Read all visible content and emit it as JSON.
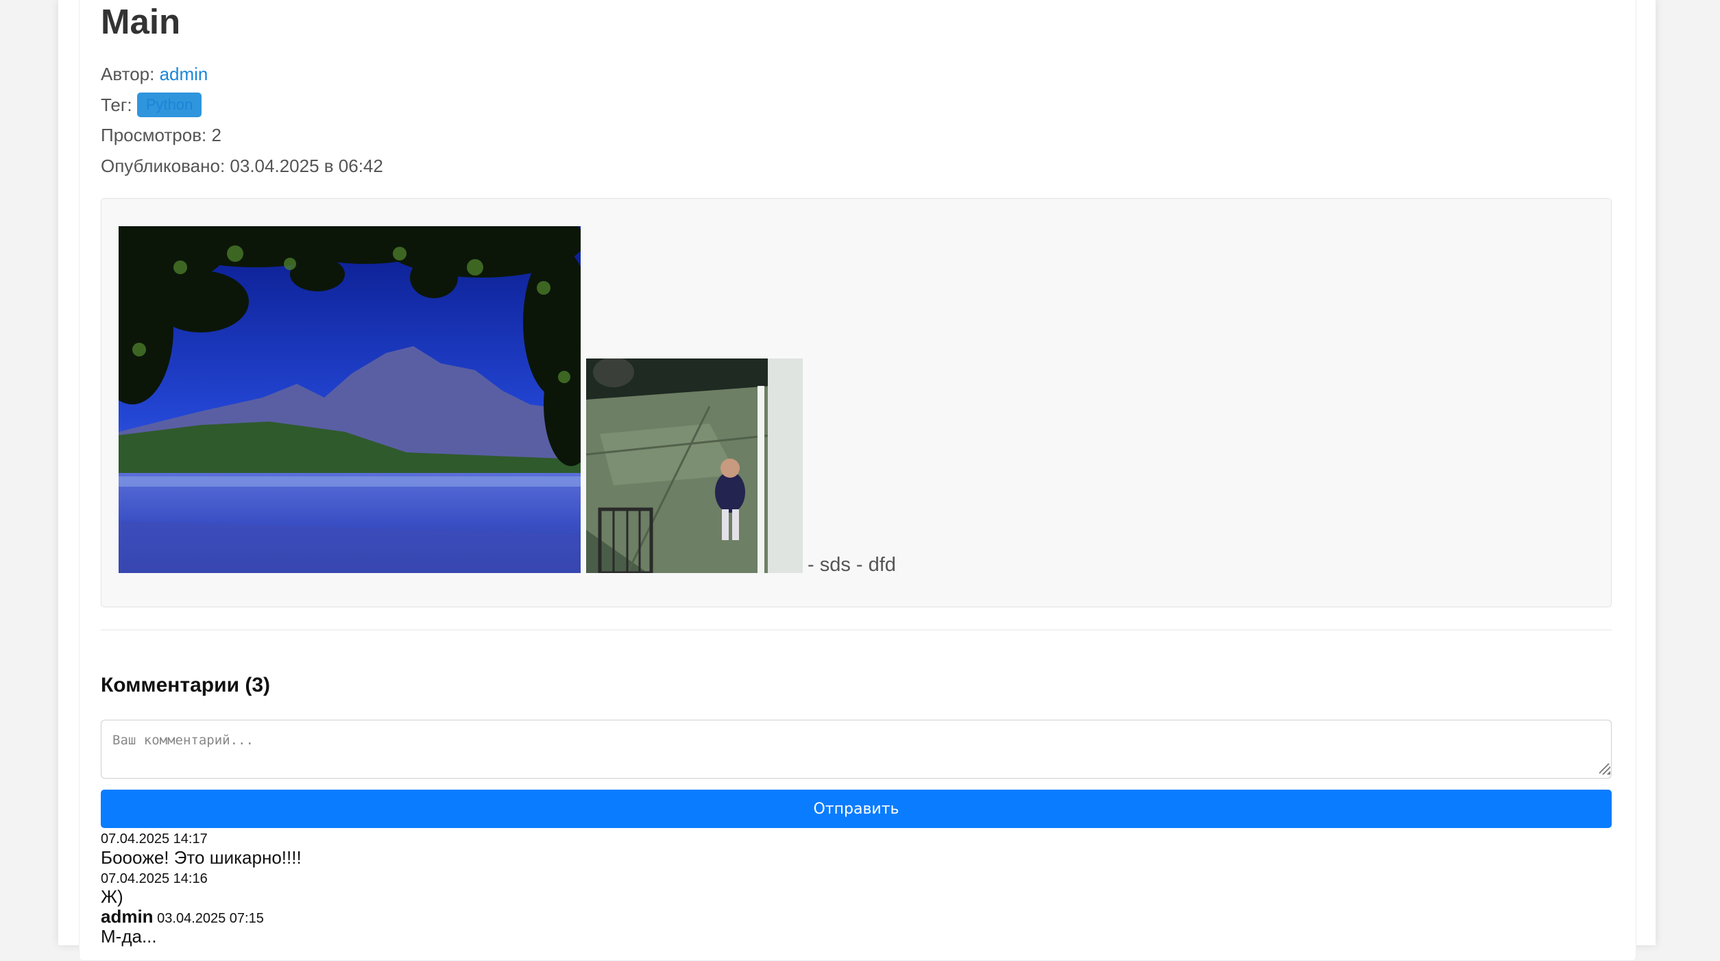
{
  "post": {
    "title": "Main",
    "author_label": "Автор:",
    "author": "admin",
    "tag_label": "Тег:",
    "tag": "Python",
    "views_label": "Просмотров:",
    "views": "2",
    "published_label": "Опубликовано:",
    "published": "03.04.2025 в 06:42",
    "caption": "- sds - dfd"
  },
  "comments": {
    "heading": "Комментарии (3)",
    "placeholder": "Ваш комментарий...",
    "submit_label": "Отправить",
    "items": [
      {
        "author": "",
        "date": "07.04.2025 14:17",
        "text": "Бoooже! Это шикарно!!!!"
      },
      {
        "author": "",
        "date": "07.04.2025 14:16",
        "text": "Ж)"
      },
      {
        "author": "admin",
        "date": "03.04.2025 07:15",
        "text": "М-да..."
      }
    ]
  },
  "colors": {
    "link": "#1a86d8",
    "tag_bg": "#2f95dc",
    "button_bg": "#0a7cff"
  }
}
